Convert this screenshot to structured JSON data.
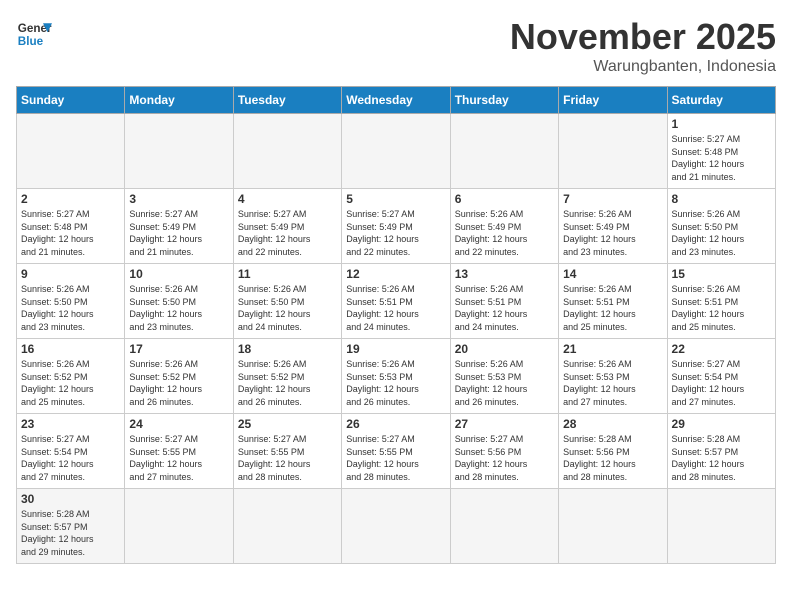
{
  "logo": {
    "line1": "General",
    "line2": "Blue"
  },
  "title": "November 2025",
  "subtitle": "Warungbanten, Indonesia",
  "headers": [
    "Sunday",
    "Monday",
    "Tuesday",
    "Wednesday",
    "Thursday",
    "Friday",
    "Saturday"
  ],
  "weeks": [
    [
      {
        "day": "",
        "info": ""
      },
      {
        "day": "",
        "info": ""
      },
      {
        "day": "",
        "info": ""
      },
      {
        "day": "",
        "info": ""
      },
      {
        "day": "",
        "info": ""
      },
      {
        "day": "",
        "info": ""
      },
      {
        "day": "1",
        "info": "Sunrise: 5:27 AM\nSunset: 5:48 PM\nDaylight: 12 hours\nand 21 minutes."
      }
    ],
    [
      {
        "day": "2",
        "info": "Sunrise: 5:27 AM\nSunset: 5:48 PM\nDaylight: 12 hours\nand 21 minutes."
      },
      {
        "day": "3",
        "info": "Sunrise: 5:27 AM\nSunset: 5:49 PM\nDaylight: 12 hours\nand 21 minutes."
      },
      {
        "day": "4",
        "info": "Sunrise: 5:27 AM\nSunset: 5:49 PM\nDaylight: 12 hours\nand 22 minutes."
      },
      {
        "day": "5",
        "info": "Sunrise: 5:27 AM\nSunset: 5:49 PM\nDaylight: 12 hours\nand 22 minutes."
      },
      {
        "day": "6",
        "info": "Sunrise: 5:26 AM\nSunset: 5:49 PM\nDaylight: 12 hours\nand 22 minutes."
      },
      {
        "day": "7",
        "info": "Sunrise: 5:26 AM\nSunset: 5:49 PM\nDaylight: 12 hours\nand 23 minutes."
      },
      {
        "day": "8",
        "info": "Sunrise: 5:26 AM\nSunset: 5:50 PM\nDaylight: 12 hours\nand 23 minutes."
      }
    ],
    [
      {
        "day": "9",
        "info": "Sunrise: 5:26 AM\nSunset: 5:50 PM\nDaylight: 12 hours\nand 23 minutes."
      },
      {
        "day": "10",
        "info": "Sunrise: 5:26 AM\nSunset: 5:50 PM\nDaylight: 12 hours\nand 23 minutes."
      },
      {
        "day": "11",
        "info": "Sunrise: 5:26 AM\nSunset: 5:50 PM\nDaylight: 12 hours\nand 24 minutes."
      },
      {
        "day": "12",
        "info": "Sunrise: 5:26 AM\nSunset: 5:51 PM\nDaylight: 12 hours\nand 24 minutes."
      },
      {
        "day": "13",
        "info": "Sunrise: 5:26 AM\nSunset: 5:51 PM\nDaylight: 12 hours\nand 24 minutes."
      },
      {
        "day": "14",
        "info": "Sunrise: 5:26 AM\nSunset: 5:51 PM\nDaylight: 12 hours\nand 25 minutes."
      },
      {
        "day": "15",
        "info": "Sunrise: 5:26 AM\nSunset: 5:51 PM\nDaylight: 12 hours\nand 25 minutes."
      }
    ],
    [
      {
        "day": "16",
        "info": "Sunrise: 5:26 AM\nSunset: 5:52 PM\nDaylight: 12 hours\nand 25 minutes."
      },
      {
        "day": "17",
        "info": "Sunrise: 5:26 AM\nSunset: 5:52 PM\nDaylight: 12 hours\nand 26 minutes."
      },
      {
        "day": "18",
        "info": "Sunrise: 5:26 AM\nSunset: 5:52 PM\nDaylight: 12 hours\nand 26 minutes."
      },
      {
        "day": "19",
        "info": "Sunrise: 5:26 AM\nSunset: 5:53 PM\nDaylight: 12 hours\nand 26 minutes."
      },
      {
        "day": "20",
        "info": "Sunrise: 5:26 AM\nSunset: 5:53 PM\nDaylight: 12 hours\nand 26 minutes."
      },
      {
        "day": "21",
        "info": "Sunrise: 5:26 AM\nSunset: 5:53 PM\nDaylight: 12 hours\nand 27 minutes."
      },
      {
        "day": "22",
        "info": "Sunrise: 5:27 AM\nSunset: 5:54 PM\nDaylight: 12 hours\nand 27 minutes."
      }
    ],
    [
      {
        "day": "23",
        "info": "Sunrise: 5:27 AM\nSunset: 5:54 PM\nDaylight: 12 hours\nand 27 minutes."
      },
      {
        "day": "24",
        "info": "Sunrise: 5:27 AM\nSunset: 5:55 PM\nDaylight: 12 hours\nand 27 minutes."
      },
      {
        "day": "25",
        "info": "Sunrise: 5:27 AM\nSunset: 5:55 PM\nDaylight: 12 hours\nand 28 minutes."
      },
      {
        "day": "26",
        "info": "Sunrise: 5:27 AM\nSunset: 5:55 PM\nDaylight: 12 hours\nand 28 minutes."
      },
      {
        "day": "27",
        "info": "Sunrise: 5:27 AM\nSunset: 5:56 PM\nDaylight: 12 hours\nand 28 minutes."
      },
      {
        "day": "28",
        "info": "Sunrise: 5:28 AM\nSunset: 5:56 PM\nDaylight: 12 hours\nand 28 minutes."
      },
      {
        "day": "29",
        "info": "Sunrise: 5:28 AM\nSunset: 5:57 PM\nDaylight: 12 hours\nand 28 minutes."
      }
    ],
    [
      {
        "day": "30",
        "info": "Sunrise: 5:28 AM\nSunset: 5:57 PM\nDaylight: 12 hours\nand 29 minutes."
      },
      {
        "day": "",
        "info": ""
      },
      {
        "day": "",
        "info": ""
      },
      {
        "day": "",
        "info": ""
      },
      {
        "day": "",
        "info": ""
      },
      {
        "day": "",
        "info": ""
      },
      {
        "day": "",
        "info": ""
      }
    ]
  ]
}
